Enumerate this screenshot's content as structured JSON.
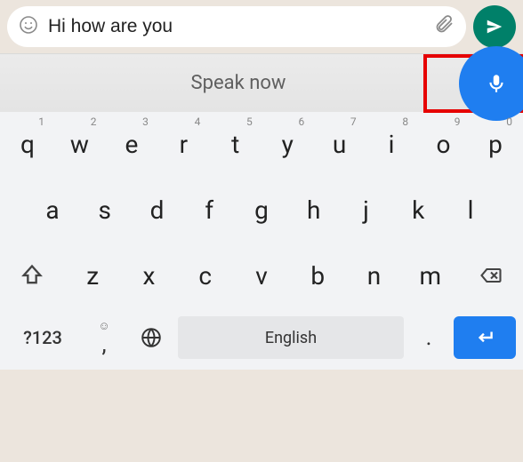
{
  "chat": {
    "message_value": "Hi how are you"
  },
  "voice": {
    "prompt_label": "Speak now"
  },
  "keyboard": {
    "row1": [
      {
        "char": "q",
        "sup": "1"
      },
      {
        "char": "w",
        "sup": "2"
      },
      {
        "char": "e",
        "sup": "3"
      },
      {
        "char": "r",
        "sup": "4"
      },
      {
        "char": "t",
        "sup": "5"
      },
      {
        "char": "y",
        "sup": "6"
      },
      {
        "char": "u",
        "sup": "7"
      },
      {
        "char": "i",
        "sup": "8"
      },
      {
        "char": "o",
        "sup": "9"
      },
      {
        "char": "p",
        "sup": "0"
      }
    ],
    "row2": [
      "a",
      "s",
      "d",
      "f",
      "g",
      "h",
      "j",
      "k",
      "l"
    ],
    "row3": [
      "z",
      "x",
      "c",
      "v",
      "b",
      "n",
      "m"
    ],
    "symbols_label": "?123",
    "comma_label": ",",
    "space_label": "English",
    "period_label": "."
  },
  "colors": {
    "send_bg": "#008069",
    "mic_bg": "#1f7ef0",
    "highlight_border": "#e60000",
    "enter_bg": "#1f7ef0"
  }
}
